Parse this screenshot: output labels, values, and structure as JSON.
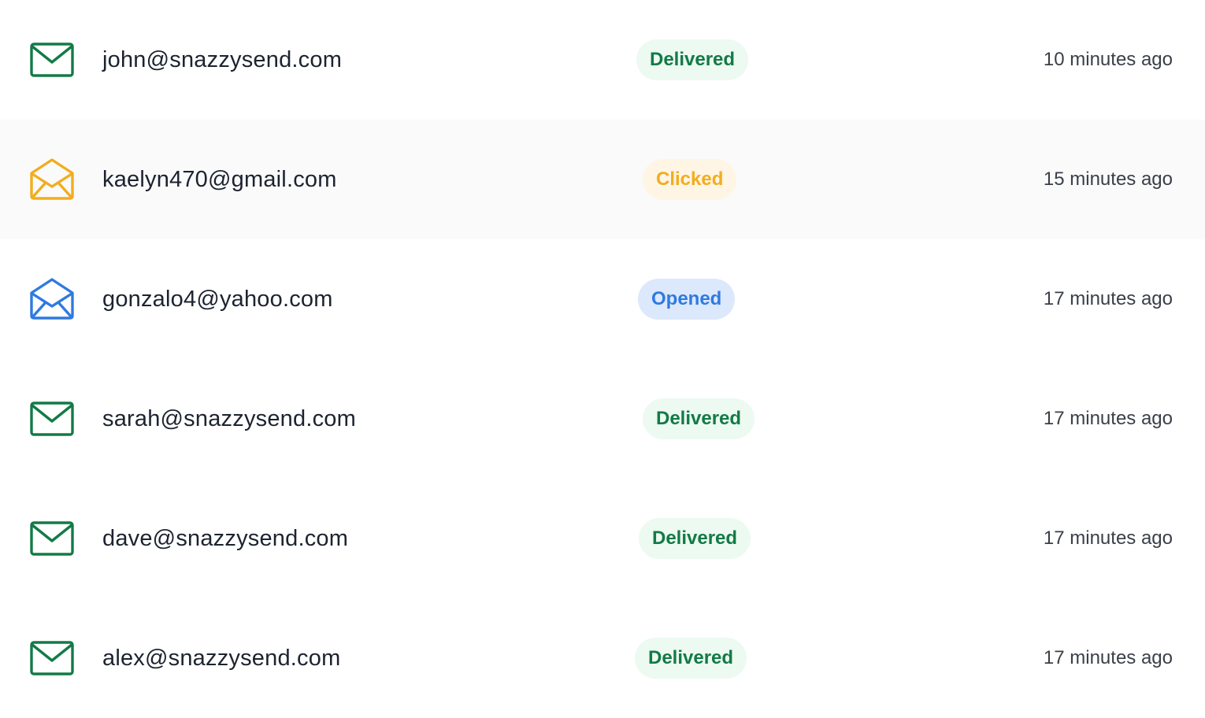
{
  "colors": {
    "delivered": "#137a46",
    "clicked": "#f2ad1f",
    "opened": "#2f7ae0",
    "delivered_bg": "#ecfaf1",
    "clicked_bg": "#fef5e5",
    "opened_bg": "#dce8fb"
  },
  "rows": [
    {
      "icon": "closed-envelope-icon",
      "email": "john@snazzysend.com",
      "status": "Delivered",
      "time": "10 minutes ago"
    },
    {
      "icon": "open-envelope-icon",
      "email": "kaelyn470@gmail.com",
      "status": "Clicked",
      "time": "15 minutes ago"
    },
    {
      "icon": "open-envelope-icon",
      "email": "gonzalo4@yahoo.com",
      "status": "Opened",
      "time": "17 minutes ago"
    },
    {
      "icon": "closed-envelope-icon",
      "email": "sarah@snazzysend.com",
      "status": "Delivered",
      "time": "17 minutes ago"
    },
    {
      "icon": "closed-envelope-icon",
      "email": "dave@snazzysend.com",
      "status": "Delivered",
      "time": "17 minutes ago"
    },
    {
      "icon": "closed-envelope-icon",
      "email": "alex@snazzysend.com",
      "status": "Delivered",
      "time": "17 minutes ago"
    }
  ]
}
